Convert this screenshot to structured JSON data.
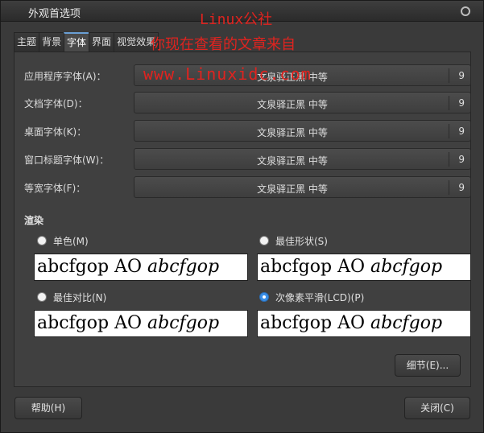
{
  "window": {
    "title": "外观首选项"
  },
  "watermark": {
    "line1": "Linux公社",
    "line2": "你现在查看的文章来自",
    "line3": "www.Linuxidc.com"
  },
  "tabs": [
    {
      "label": "主题"
    },
    {
      "label": "背景"
    },
    {
      "label": "字体"
    },
    {
      "label": "界面"
    },
    {
      "label": "视觉效果"
    }
  ],
  "fonts": [
    {
      "label": "应用程序字体(A)：",
      "font": "文泉驿正黑 中等",
      "size": "9"
    },
    {
      "label": "文档字体(D)：",
      "font": "文泉驿正黑 中等",
      "size": "9"
    },
    {
      "label": "桌面字体(K)：",
      "font": "文泉驿正黑 中等",
      "size": "9"
    },
    {
      "label": "窗口标题字体(W)：",
      "font": "文泉驿正黑 中等",
      "size": "9"
    },
    {
      "label": "等宽字体(F)：",
      "font": "文泉驿正黑 中等",
      "size": "9"
    }
  ],
  "rendering": {
    "title": "渲染",
    "options": [
      {
        "label": "单色(M)",
        "selected": false
      },
      {
        "label": "最佳形状(S)",
        "selected": false
      },
      {
        "label": "最佳对比(N)",
        "selected": false
      },
      {
        "label": "次像素平滑(LCD)(P)",
        "selected": true
      }
    ],
    "preview_normal": "abcfgop AO",
    "preview_italic": "abcfgop"
  },
  "buttons": {
    "details": "细节(E)...",
    "help": "帮助(H)",
    "close": "关闭(C)"
  }
}
